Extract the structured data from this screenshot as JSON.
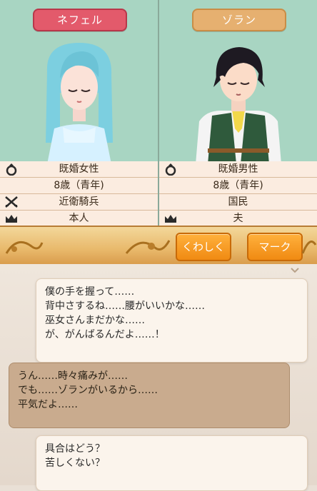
{
  "characters": [
    {
      "name": "ネフェル",
      "stats": [
        "既婚女性",
        "8歳（青年)",
        "近衛騎兵",
        "本人"
      ],
      "plate_color": "#e35a6b"
    },
    {
      "name": "ゾラン",
      "stats": [
        "既婚男性",
        "8歳（青年)",
        "国民",
        "夫"
      ],
      "plate_color": "#e6b070"
    }
  ],
  "buttons": {
    "detail": "くわしく",
    "mark": "マーク"
  },
  "messages": [
    {
      "speaker": "right",
      "text": "僕の手を握って……\n背中さするね……腰がいいかな……\n巫女さんまだかな……\nが、がんばるんだよ……！"
    },
    {
      "speaker": "left",
      "text": "うん……時々痛みが……\nでも……ゾランがいるから……\n平気だよ……"
    },
    {
      "speaker": "right",
      "text": "具合はどう？\n苦しくない？"
    }
  ],
  "icons": [
    "ring-icon",
    "crossed-swords-icon",
    "crown-icon"
  ]
}
